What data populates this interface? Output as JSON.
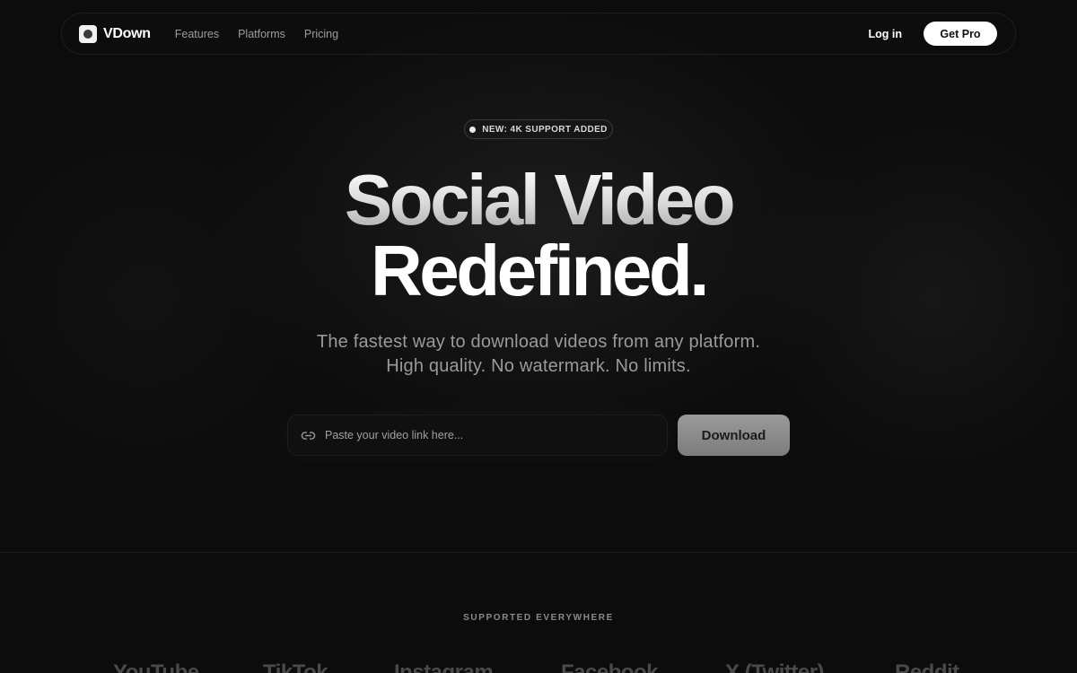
{
  "nav": {
    "brand": "VDown",
    "links": [
      "Features",
      "Platforms",
      "Pricing"
    ],
    "login": "Log in",
    "cta": "Get Pro"
  },
  "hero": {
    "badge": "NEW: 4K SUPPORT ADDED",
    "title_line1": "Social Video",
    "title_line2": "Redefined.",
    "subtitle_line1": "The fastest way to download videos from any platform.",
    "subtitle_line2": "High quality. No watermark. No limits."
  },
  "search": {
    "placeholder": "Paste your video link here...",
    "value": "",
    "icon": "link-icon",
    "button": "Download"
  },
  "supported": {
    "heading": "SUPPORTED EVERYWHERE",
    "platforms": [
      "YouTube",
      "TikTok",
      "Instagram",
      "Facebook",
      "X (Twitter)",
      "Reddit"
    ]
  },
  "colors": {
    "background": "#0c0c0c",
    "accent": "#ffffff",
    "button": "#8a8a8a"
  }
}
